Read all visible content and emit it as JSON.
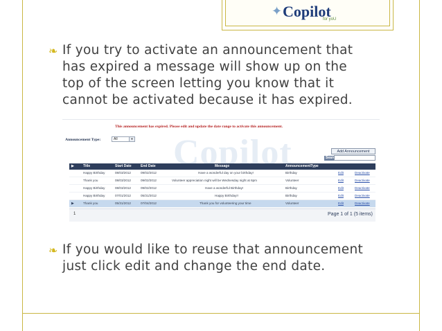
{
  "logo": {
    "text": "Copilot",
    "tagline": "for yoU"
  },
  "bullets": [
    {
      "lines": [
        "If you try to activate an announcement that",
        "has expired a message will show up on the",
        "top of the screen letting you know that it",
        "cannot be activated because it has expired."
      ]
    },
    {
      "lines": [
        "If you would like to reuse that announcement",
        "just click edit and change the end date."
      ]
    }
  ],
  "screenshot": {
    "error": "This announcement has expired. Please edit and update the date range to activate this announcement.",
    "watermark": "Copilot",
    "type_label": "Announcement Type:",
    "type_value": "All",
    "add_button": "Add Announcement",
    "search_label": "Search",
    "columns": [
      "Title",
      "Start Date",
      "End Date",
      "Message",
      "AnnouncementType"
    ],
    "rows": [
      {
        "title": "Happy Birthday",
        "start": "08/03/2012",
        "end": "09/02/2012",
        "message": "Have a wonderful day on your birthday!",
        "type": "Birthday",
        "edit": "Edit",
        "deactivate": "Deactivate"
      },
      {
        "title": "Thank you",
        "start": "08/03/2012",
        "end": "09/02/2012",
        "message": "Volunteer appreciation night will be Wednesday night at 6pm",
        "type": "Volunteer",
        "edit": "Edit",
        "deactivate": "Deactivate"
      },
      {
        "title": "Happy Birthday",
        "start": "08/03/2012",
        "end": "09/02/2012",
        "message": "Have a wonderful Birthday!",
        "type": "Birthday",
        "edit": "Edit",
        "deactivate": "Deactivate"
      },
      {
        "title": "Happy Birthday",
        "start": "07/01/2012",
        "end": "05/31/2012",
        "message": "Happy Birthday!!",
        "type": "Birthday",
        "edit": "Edit",
        "deactivate": "Deactivate"
      },
      {
        "title": "Thank you",
        "start": "05/31/2012",
        "end": "07/04/2012",
        "message": "Thank you for volunteering your time",
        "type": "Volunteer",
        "edit": "Edit",
        "deactivate": "Deactivate"
      }
    ],
    "pager": {
      "current_page": "1",
      "info": "Page 1 of 1 (5 items)"
    }
  }
}
